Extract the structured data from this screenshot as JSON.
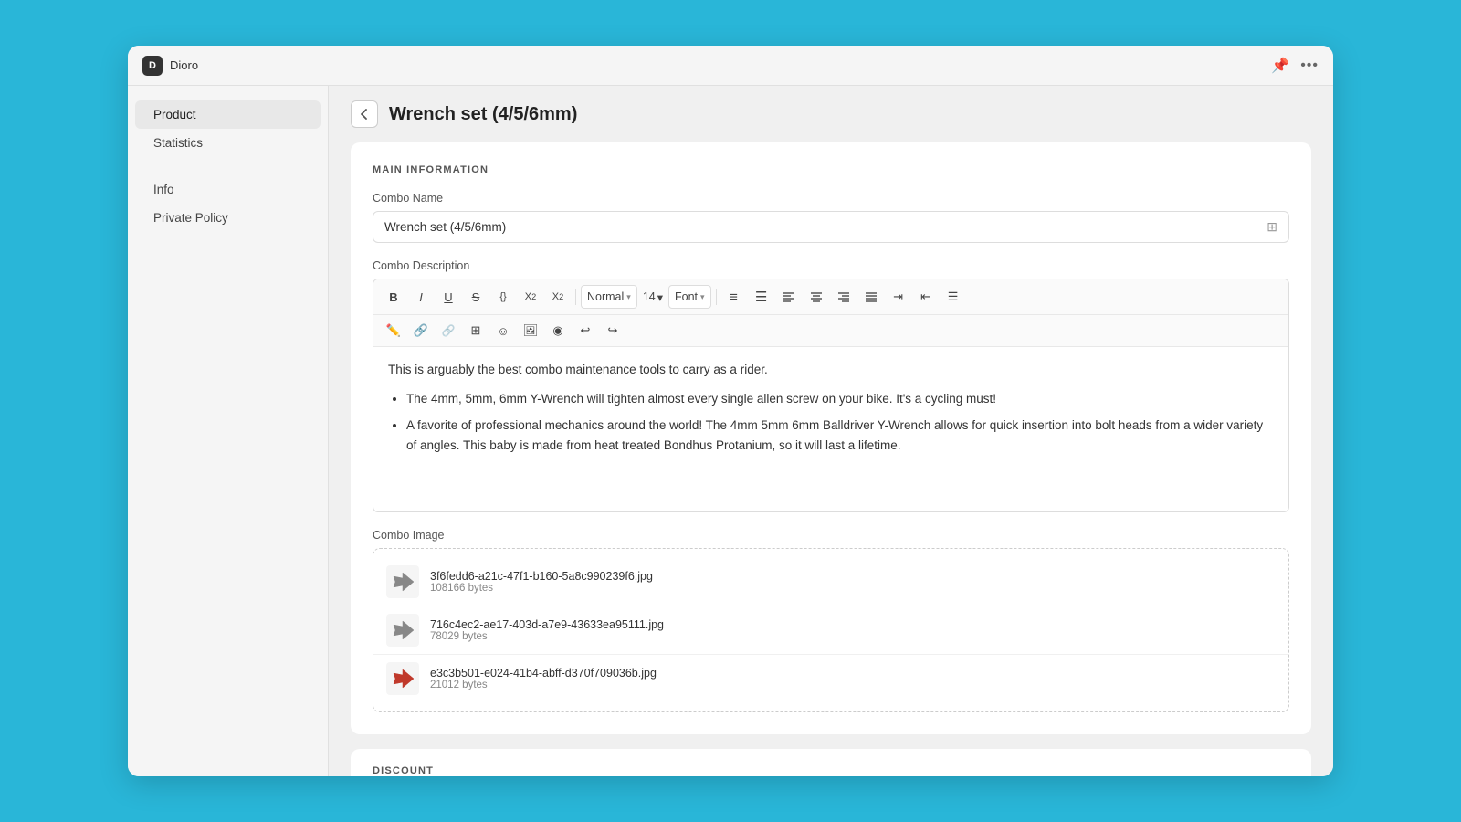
{
  "app": {
    "logo_text": "D",
    "name": "Dioro"
  },
  "titlebar": {
    "pin_icon": "📌",
    "dots_icon": "···"
  },
  "sidebar": {
    "items": [
      {
        "id": "product",
        "label": "Product",
        "active": true
      },
      {
        "id": "statistics",
        "label": "Statistics",
        "active": false
      },
      {
        "id": "info",
        "label": "Info",
        "active": false
      },
      {
        "id": "private-policy",
        "label": "Private Policy",
        "active": false
      }
    ]
  },
  "page": {
    "title": "Wrench set (4/5/6mm)",
    "back_label": "←"
  },
  "main_info": {
    "section_title": "MAIN INFORMATION",
    "combo_name_label": "Combo Name",
    "combo_name_value": "Wrench set (4/5/6mm)",
    "combo_desc_label": "Combo Description",
    "editor_content_intro": "This is arguably the best combo maintenance tools to carry as a rider.",
    "editor_bullet_1": "The 4mm, 5mm, 6mm Y-Wrench will tighten almost every single allen screw on your bike. It's a cycling must!",
    "editor_bullet_2": "A favorite of professional mechanics around the world! The 4mm 5mm 6mm Balldriver Y-Wrench allows for quick insertion into bolt heads from a wider variety of angles. This baby is made from heat treated Bondhus Protanium, so it will last a lifetime.",
    "toolbar": {
      "bold": "B",
      "italic": "I",
      "underline": "U",
      "strikethrough": "S",
      "code": "{}",
      "superscript": "X²",
      "subscript": "X₂",
      "style_label": "Normal",
      "style_arrow": "▾",
      "font_size": "14",
      "font_size_arrow": "▾",
      "font_label": "Font",
      "font_arrow": "▾"
    },
    "combo_image_label": "Combo Image",
    "images": [
      {
        "filename": "3f6fedd6-a21c-47f1-b160-5a8c990239f6.jpg",
        "size": "108166 bytes",
        "icon_color": "gray"
      },
      {
        "filename": "716c4ec2-ae17-403d-a7e9-43633ea95111.jpg",
        "size": "78029 bytes",
        "icon_color": "gray"
      },
      {
        "filename": "e3c3b501-e024-41b4-abff-d370f709036b.jpg",
        "size": "21012 bytes",
        "icon_color": "red"
      }
    ]
  },
  "discount": {
    "section_title": "DISCOUNT"
  }
}
